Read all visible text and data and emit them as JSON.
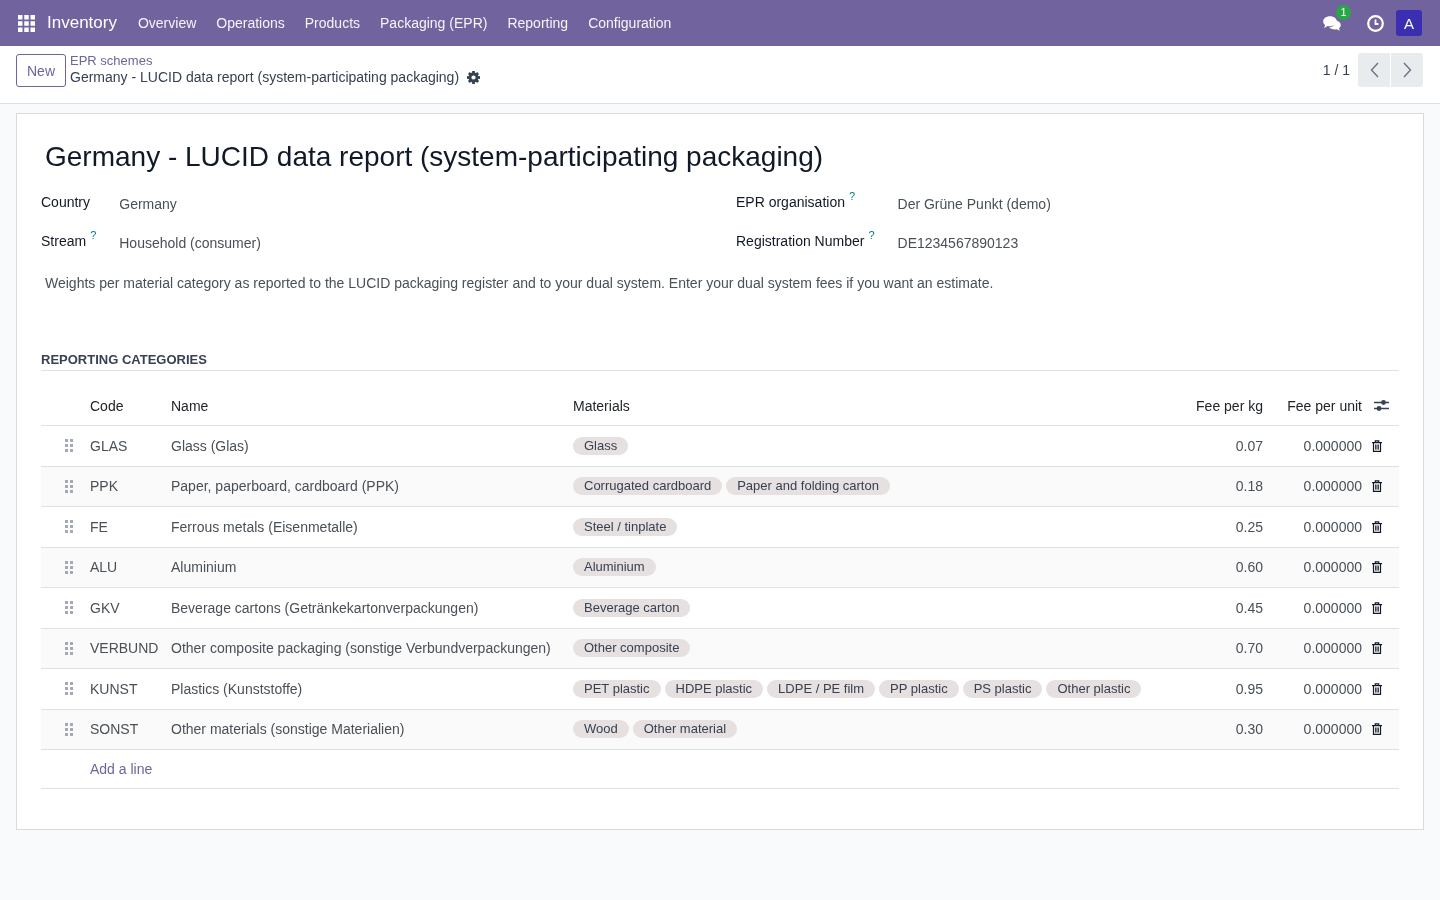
{
  "navbar": {
    "app_name": "Inventory",
    "menu": [
      "Overview",
      "Operations",
      "Products",
      "Packaging (EPR)",
      "Reporting",
      "Configuration"
    ],
    "message_count": "1",
    "avatar_initial": "A"
  },
  "control_panel": {
    "new_button": "New",
    "breadcrumb": "EPR schemes",
    "record_title": "Germany - LUCID data report (system-participating packaging)",
    "pager": "1 / 1"
  },
  "form": {
    "title": "Germany - LUCID data report (system-participating packaging)",
    "field_groups": [
      {
        "fields": [
          {
            "label": "Country",
            "value": "Germany"
          },
          {
            "label": "Stream",
            "help": "?",
            "value": "Household (consumer)"
          }
        ]
      },
      {
        "fields": [
          {
            "label": "EPR organisation",
            "help": "?",
            "value": "Der Grüne Punkt (demo)"
          },
          {
            "label": "Registration Number",
            "help": "?",
            "value": "DE1234567890123"
          }
        ]
      }
    ],
    "description": "Weights per material category as reported to the LUCID packaging register and to your dual system. Enter your dual system fees if you want an estimate.",
    "section_title": "REPORTING CATEGORIES",
    "table": {
      "columns": [
        {
          "label": "Code",
          "kind": "text"
        },
        {
          "label": "Name",
          "kind": "text"
        },
        {
          "label": "Materials",
          "kind": "tags"
        },
        {
          "label": "Fee per kg",
          "kind": "number"
        },
        {
          "label": "Fee per unit",
          "kind": "number"
        }
      ],
      "rows": [
        {
          "code": "GLAS",
          "name": "Glass (Glas)",
          "materials": [
            "Glass"
          ],
          "fee_per_kg": "0.07",
          "fee_per_unit": "0.000000"
        },
        {
          "code": "PPK",
          "name": "Paper, paperboard, cardboard (PPK)",
          "materials": [
            "Corrugated cardboard",
            "Paper and folding carton"
          ],
          "fee_per_kg": "0.18",
          "fee_per_unit": "0.000000"
        },
        {
          "code": "FE",
          "name": "Ferrous metals (Eisenmetalle)",
          "materials": [
            "Steel / tinplate"
          ],
          "fee_per_kg": "0.25",
          "fee_per_unit": "0.000000"
        },
        {
          "code": "ALU",
          "name": "Aluminium",
          "materials": [
            "Aluminium"
          ],
          "fee_per_kg": "0.60",
          "fee_per_unit": "0.000000"
        },
        {
          "code": "GKV",
          "name": "Beverage cartons (Getränkekartonverpackungen)",
          "materials": [
            "Beverage carton"
          ],
          "fee_per_kg": "0.45",
          "fee_per_unit": "0.000000"
        },
        {
          "code": "VERBUND",
          "name": "Other composite packaging (sonstige Verbundverpackungen)",
          "materials": [
            "Other composite"
          ],
          "fee_per_kg": "0.70",
          "fee_per_unit": "0.000000"
        },
        {
          "code": "KUNST",
          "name": "Plastics (Kunststoffe)",
          "materials": [
            "PET plastic",
            "HDPE plastic",
            "LDPE / PE film",
            "PP plastic",
            "PS plastic",
            "Other plastic"
          ],
          "fee_per_kg": "0.95",
          "fee_per_unit": "0.000000"
        },
        {
          "code": "SONST",
          "name": "Other materials (sonstige Materialien)",
          "materials": [
            "Wood",
            "Other material"
          ],
          "fee_per_kg": "0.30",
          "fee_per_unit": "0.000000"
        }
      ],
      "add_line": "Add a line"
    }
  }
}
